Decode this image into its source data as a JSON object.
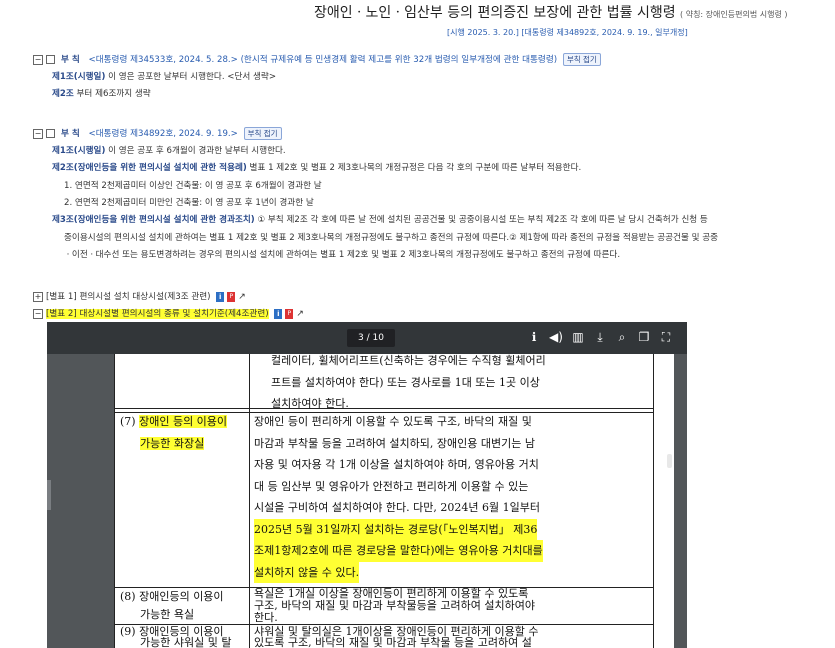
{
  "header": {
    "title": "장애인ㆍ노인ㆍ임산부 등의 편의증진 보장에 관한 법률 시행령",
    "abbrev": "( 약칭: 장애인등편의법 시행령 )",
    "effective": "[시행 2025. 3. 20.] [대통령령 제34892호, 2024. 9. 19., 일부개정]"
  },
  "addenda": [
    {
      "heading": "부      칙",
      "ref": "<대통령령 제34533호, 2024. 5. 28.> (한시적 규제유예 등 민생경제 활력 제고를 위한 32개 법령의 일부개정에 관한 대통령령)",
      "button": "부칙 접기",
      "lines": [
        {
          "art": "제1조(시행일)",
          "text": " 이 영은 공포한 날부터 시행한다. <단서 생략>"
        },
        {
          "art": "제2조",
          "text": " 부터 제6조까지 생략"
        }
      ]
    },
    {
      "heading": "부      칙",
      "ref": "<대통령령 제34892호, 2024. 9. 19.>",
      "button": "부칙 접기",
      "lines": [
        {
          "art": "제1조(시행일)",
          "text": " 이 영은 공포 후 6개월이 경과한 날부터 시행한다."
        },
        {
          "art": "제2조(장애인등을 위한 편의시설 설치에 관한 적용례)",
          "text": " 별표 1 제2호 및 별표 2 제3호나목의 개정규정은 다음 각 호의 구분에 따른 날부터 적용한다."
        },
        {
          "art": "",
          "text": "1. 연면적 2천제곱미터 이상인 건축물: 이 영 공포 후 6개월이 경과한 날"
        },
        {
          "art": "",
          "text": "2. 연면적 2천제곱미터 미만인 건축물: 이 영 공포 후 1년이 경과한 날"
        },
        {
          "art": "제3조(장애인등을 위한 편의시설 설치에 관한 경과조치)",
          "text": " ① 부칙 제2조 각 호에 따른 날 전에 설치된 공공건물 및 공중이용시설 또는 부칙 제2조 각 호에 따른 날 당시 건축허가 신청 등"
        },
        {
          "art": "",
          "text": "중이용시설의 편의시설 설치에 관하여는 별표 1 제2호 및 별표 2 제3호나목의 개정규정에도 불구하고 종전의 규정에 따른다.② 제1항에 따라 종전의 규정을 적용받는 공공건물 및 공중"
        },
        {
          "art": "",
          "text": "ㆍ이전ㆍ대수선 또는 용도변경하려는 경우의 편의시설 설치에 관하여는 별표 1 제2호 및 별표 2 제3호나목의 개정규정에도 불구하고 종전의 규정에 따른다."
        }
      ]
    }
  ],
  "annexes": [
    {
      "label": "[별표 1] 편의시설 설치 대상시설(제3조 관련)"
    },
    {
      "label": "[별표 2] 대상시설별 편의시설의 종류 및 설치기준(제4조관련)"
    }
  ],
  "viewer": {
    "page": "3 / 10",
    "icons": [
      "info-icon",
      "speaker-icon",
      "layout-icon",
      "download-icon",
      "search-icon",
      "pages-icon",
      "fullscreen-icon"
    ],
    "rows": [
      {
        "num": "",
        "lines": [
          ""
        ],
        "desc": [
          "컬레이터, 휠체어리프트(신축하는 경우에는 수직형 휠체어리",
          "프트를 설치하여야 한다) 또는 경사로를 1대 또는 1곳 이상",
          "설치하여야 한다."
        ]
      },
      {
        "num": "(7)",
        "lines": [
          "장애인 등의 이용이",
          "가능한 화장실"
        ],
        "desc": [
          "장애인 등이 편리하게 이용할 수 있도록 구조, 바닥의 재질 및",
          "마감과 부착물 등을 고려하여 설치하되, 장애인용 대변기는 남",
          "자용 및 여자용 각 1개 이상을 설치하여야 하며, 영유아용 거치",
          "대 등 임산부 및 영유아가 안전하고 편리하게 이용할 수 있는",
          "시설을 구비하여 설치하여야 한다. 다만, 2024년 6월 1일부터",
          "2025년 5월 31일까지 설치하는 경로당(「노인복지법」 제36",
          "조제1항제2호에 따른 경로당을 말한다)에는 영유아용 거치대를",
          "설치하지 않을 수 있다."
        ]
      },
      {
        "num": "(8)",
        "lines": [
          "장애인등의 이용이",
          "가능한 욕실"
        ],
        "desc": [
          "욕실은 1개실 이상을 장애인등이 편리하게 이용할 수 있도록",
          "구조, 바닥의 재질 및 마감과 부착물등을 고려하여 설치하여야",
          "한다."
        ]
      },
      {
        "num": "(9)",
        "lines": [
          "장애인등의 이용이",
          "가능한 샤워실 및 탈"
        ],
        "desc": [
          "샤워실 및 탈의실은 1개이상을 장애인등이 편리하게 이용할 수",
          "있도록 구조, 바닥의 재질 및 마감과 부착물 등을 고려하여 설"
        ]
      }
    ]
  }
}
